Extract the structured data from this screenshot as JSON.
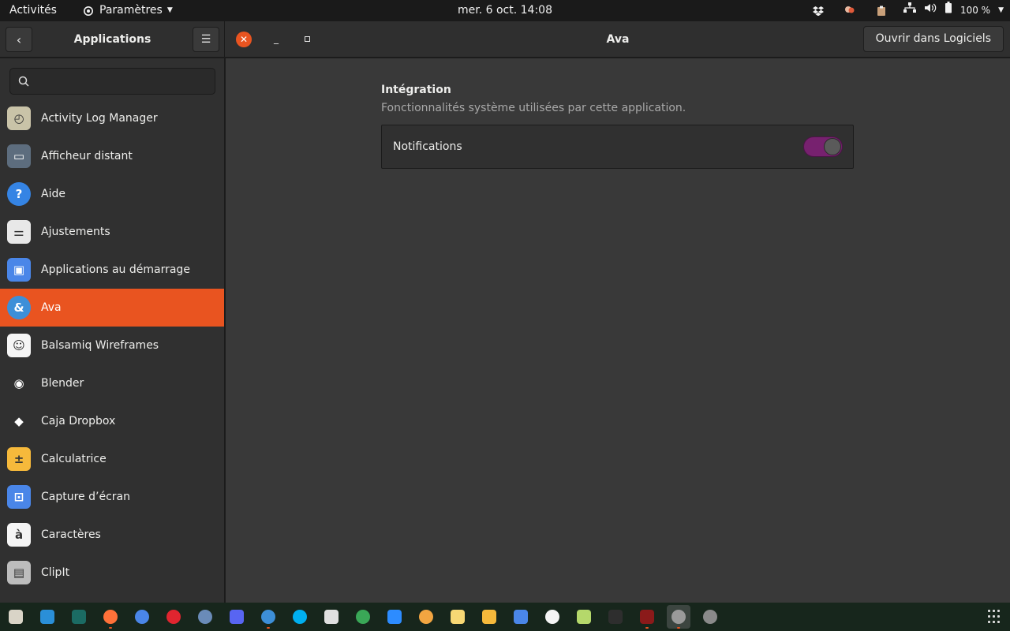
{
  "topbar": {
    "activities": "Activités",
    "app_menu": "Paramètres",
    "clock": "mer. 6 oct.  14:08",
    "battery": "100 %"
  },
  "header": {
    "left_title": "Applications",
    "window_title": "Ava",
    "open_button": "Ouvrir dans Logiciels"
  },
  "search": {
    "placeholder": "",
    "value": ""
  },
  "apps": [
    {
      "label": "Activity Log Manager",
      "icon": "activity-log-icon",
      "color": "#c9c3a8",
      "glyph": "◴"
    },
    {
      "label": "Afficheur distant",
      "icon": "remote-viewer-icon",
      "color": "#5d6d7e",
      "glyph": "▭"
    },
    {
      "label": "Aide",
      "icon": "help-icon",
      "color": "#3584e4",
      "glyph": "?"
    },
    {
      "label": "Ajustements",
      "icon": "tweaks-icon",
      "color": "#e8e8e8",
      "glyph": "⚌"
    },
    {
      "label": "Applications au démarrage",
      "icon": "startup-apps-icon",
      "color": "#4a86e8",
      "glyph": "▣"
    },
    {
      "label": "Ava",
      "icon": "ava-icon",
      "color": "#3d8fd8",
      "glyph": "&"
    },
    {
      "label": "Balsamiq Wireframes",
      "icon": "balsamiq-icon",
      "color": "#f5f5f5",
      "glyph": "☺"
    },
    {
      "label": "Blender",
      "icon": "blender-icon",
      "color": "#303030",
      "glyph": "◉"
    },
    {
      "label": "Caja Dropbox",
      "icon": "dropbox-icon",
      "color": "#303030",
      "glyph": "◆"
    },
    {
      "label": "Calculatrice",
      "icon": "calculator-icon",
      "color": "#f6b93b",
      "glyph": "±"
    },
    {
      "label": "Capture d’écran",
      "icon": "screenshot-icon",
      "color": "#4a86e8",
      "glyph": "⊡"
    },
    {
      "label": "Caractères",
      "icon": "characters-icon",
      "color": "#f5f5f5",
      "glyph": "à"
    },
    {
      "label": "ClipIt",
      "icon": "clipit-icon",
      "color": "#bdbdbd",
      "glyph": "▤"
    }
  ],
  "selected_app": "Ava",
  "content": {
    "section_title": "Intégration",
    "section_subtitle": "Fonctionnalités système utilisées par cette application.",
    "notifications_label": "Notifications",
    "notifications_enabled": true
  },
  "colors": {
    "accent": "#e95420",
    "toggle_on": "#77216f"
  },
  "dock": [
    {
      "icon": "files-icon",
      "color": "#d9d4c7",
      "running": false
    },
    {
      "icon": "vscode-icon",
      "color": "#2a8fd8",
      "running": false
    },
    {
      "icon": "gitkraken-icon",
      "color": "#1b6b63",
      "running": false
    },
    {
      "icon": "firefox-icon",
      "color": "#ff7139",
      "running": true
    },
    {
      "icon": "chrome-icon",
      "color": "#4a86e8",
      "running": false
    },
    {
      "icon": "opera-icon",
      "color": "#e0252f",
      "running": false
    },
    {
      "icon": "globe-icon",
      "color": "#6a8bb8",
      "running": false
    },
    {
      "icon": "discord-icon",
      "color": "#5865f2",
      "running": false
    },
    {
      "icon": "ava-icon",
      "color": "#3d8fd8",
      "running": true
    },
    {
      "icon": "skype-icon",
      "color": "#00aff0",
      "running": false
    },
    {
      "icon": "slack-icon",
      "color": "#e0e0e0",
      "running": false
    },
    {
      "icon": "yandex-icon",
      "color": "#3aa757",
      "running": false
    },
    {
      "icon": "zoom-icon",
      "color": "#2d8cff",
      "running": false
    },
    {
      "icon": "orange-app-icon",
      "color": "#f2a541",
      "running": false
    },
    {
      "icon": "notes-icon",
      "color": "#f7d774",
      "running": false
    },
    {
      "icon": "calculator-icon",
      "color": "#f6b93b",
      "running": false
    },
    {
      "icon": "screenshot-icon",
      "color": "#4a86e8",
      "running": false
    },
    {
      "icon": "balsamiq-icon",
      "color": "#f5f5f5",
      "running": false
    },
    {
      "icon": "tweaks-icon",
      "color": "#b5d86b",
      "running": false
    },
    {
      "icon": "terminal-icon",
      "color": "#2e2e2e",
      "running": false
    },
    {
      "icon": "wine-icon",
      "color": "#8b1a1a",
      "running": true
    },
    {
      "icon": "settings-icon",
      "color": "#9a9a9a",
      "running": true,
      "active": true
    },
    {
      "icon": "disk-icon",
      "color": "#8a8a8a",
      "running": false
    }
  ]
}
